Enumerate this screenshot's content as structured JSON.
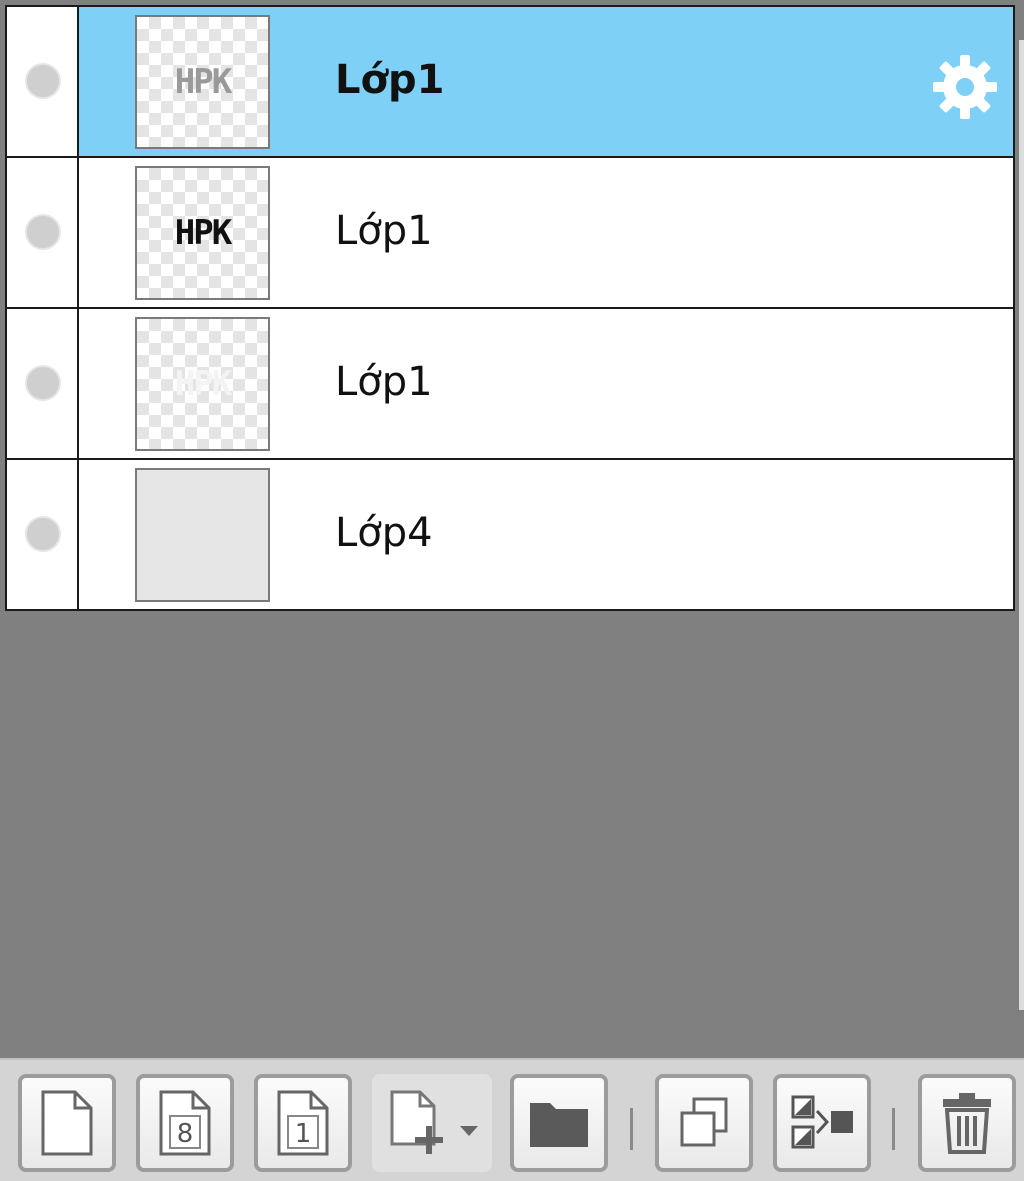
{
  "layers": [
    {
      "name": "Lớp1",
      "thumb_text": "HPK",
      "thumb_style": "faint",
      "selected": true,
      "visibility_icon": "visibility-dot-icon",
      "settings_icon": "gear-icon"
    },
    {
      "name": "Lớp1",
      "thumb_text": "HPK",
      "thumb_style": "dark",
      "selected": false,
      "visibility_icon": "visibility-dot-icon"
    },
    {
      "name": "Lớp1",
      "thumb_text": "HPK",
      "thumb_style": "ghost",
      "selected": false,
      "visibility_icon": "visibility-dot-icon"
    },
    {
      "name": "Lớp4",
      "thumb_text": "",
      "thumb_style": "plain",
      "selected": false,
      "visibility_icon": "visibility-dot-icon"
    }
  ],
  "toolbar": {
    "buttons": [
      {
        "id": "new-layer",
        "icon": "page-icon"
      },
      {
        "id": "new-8bit-layer",
        "icon": "page-8-icon",
        "label": "8"
      },
      {
        "id": "new-1bit-layer",
        "icon": "page-1-icon",
        "label": "1"
      },
      {
        "id": "new-layer-dropdown",
        "icon": "page-plus-dropdown-icon"
      },
      {
        "id": "new-folder",
        "icon": "folder-icon"
      },
      {
        "id": "duplicate-layer",
        "icon": "duplicate-icon"
      },
      {
        "id": "merge-layer",
        "icon": "merge-icon"
      },
      {
        "id": "delete-layer",
        "icon": "trash-icon"
      }
    ]
  },
  "colors": {
    "selected_row": "#7fd0f7",
    "panel_background": "#808080",
    "toolbar_background": "#d4d4d4"
  }
}
